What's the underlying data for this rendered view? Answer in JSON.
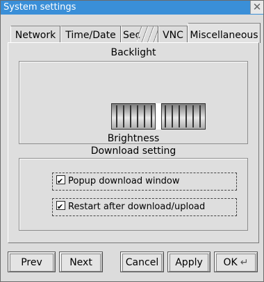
{
  "window": {
    "title": "System settings"
  },
  "tabs": [
    {
      "label": "Network"
    },
    {
      "label": "Time/Date"
    },
    {
      "label": "Sec"
    },
    {
      "label": "VNC"
    },
    {
      "label": "Miscellaneous"
    }
  ],
  "backlight": {
    "section_title": "Backlight",
    "slider_label": "Brightness",
    "brightness_fraction": 0.5
  },
  "download": {
    "section_title": "Download setting",
    "options": [
      {
        "label": "Popup download window",
        "checked": true
      },
      {
        "label": "Restart after download/upload",
        "checked": true
      }
    ]
  },
  "buttons": {
    "prev": "Prev",
    "next": "Next",
    "cancel": "Cancel",
    "apply": "Apply",
    "ok": "OK"
  },
  "icons": {
    "close": "close-icon",
    "return": "return-icon"
  },
  "colors": {
    "titlebar": "#3a8fd8"
  }
}
